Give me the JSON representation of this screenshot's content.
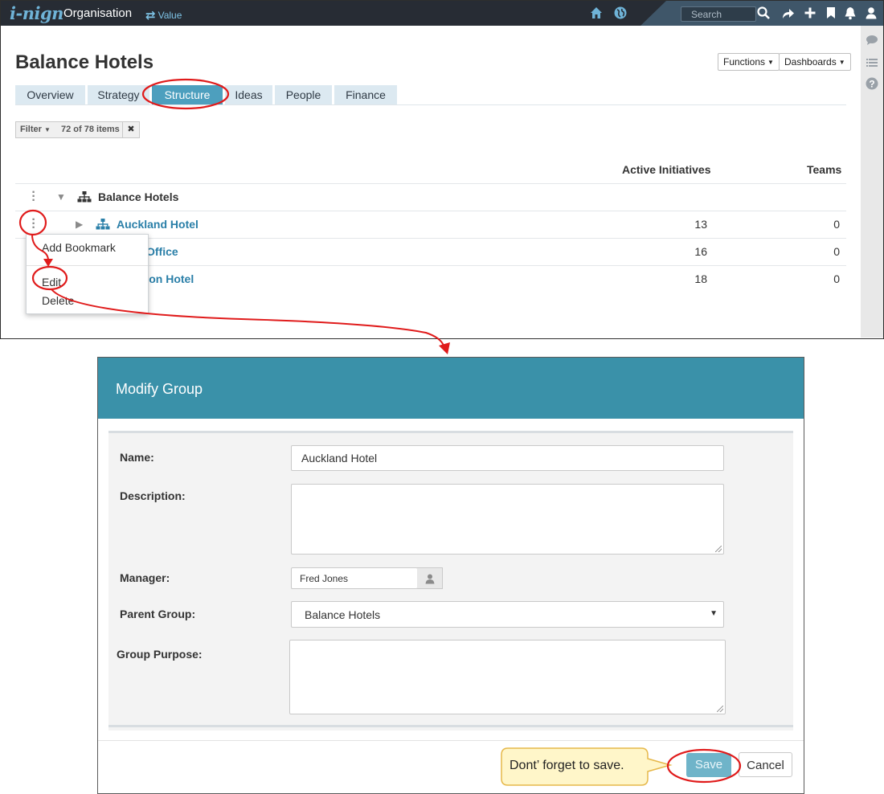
{
  "topbar": {
    "logo": "i-nign",
    "org_title": "Organisation",
    "value_link": "Value",
    "search_placeholder": "Search",
    "icons": [
      "home-icon",
      "globe-icon",
      "search-icon",
      "share-icon",
      "plus-icon",
      "bookmark-icon",
      "bell-icon",
      "user-icon"
    ]
  },
  "right_rail": {
    "icons": [
      "comment-icon",
      "list-icon",
      "help-icon"
    ]
  },
  "page": {
    "title": "Balance Hotels",
    "functions_label": "Functions",
    "dashboards_label": "Dashboards"
  },
  "tabs": [
    {
      "label": "Overview",
      "active": false
    },
    {
      "label": "Strategy",
      "active": false
    },
    {
      "label": "Structure",
      "active": true
    },
    {
      "label": "Ideas",
      "active": false
    },
    {
      "label": "People",
      "active": false
    },
    {
      "label": "Finance",
      "active": false
    }
  ],
  "filter": {
    "label": "Filter",
    "count": "72 of 78 items"
  },
  "table": {
    "columns": [
      "Active Initiatives",
      "Teams"
    ],
    "rows": [
      {
        "name": "Balance Hotels",
        "initiatives": "",
        "teams": ""
      },
      {
        "name": "Auckland Hotel",
        "initiatives": "13",
        "teams": "0"
      },
      {
        "name": "Office",
        "initiatives": "16",
        "teams": "0"
      },
      {
        "name": "gton Hotel",
        "initiatives": "18",
        "teams": "0"
      }
    ]
  },
  "context_menu": {
    "items": [
      "Add Bookmark",
      "Edit",
      "Delete"
    ]
  },
  "dialog": {
    "title": "Modify Group",
    "labels": {
      "name": "Name:",
      "description": "Description:",
      "manager": "Manager:",
      "parent_group": "Parent Group:",
      "group_purpose": "Group Purpose:"
    },
    "values": {
      "name": "Auckland Hotel",
      "description": "",
      "manager": "Fred Jones",
      "parent_group": "Balance Hotels",
      "group_purpose": ""
    },
    "save_label": "Save",
    "cancel_label": "Cancel"
  },
  "annotation": {
    "tooltip": "Dont’ forget to save."
  },
  "colors": {
    "topbar": "#272c34",
    "accent": "#3a91a9",
    "active_tab": "#4d9fbe",
    "link": "#2a7fa8",
    "callout_red": "#e01b1b",
    "tooltip_fill": "#fff6c9",
    "tooltip_border": "#e6b84a"
  }
}
